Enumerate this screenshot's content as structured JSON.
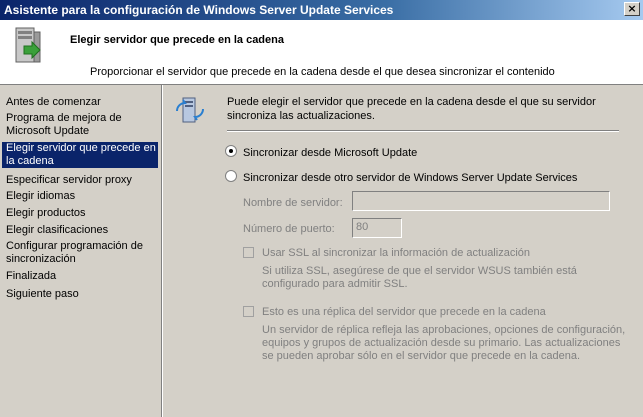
{
  "window": {
    "title": "Asistente para la configuración de Windows Server Update Services",
    "close_glyph": "×"
  },
  "header": {
    "title": "Elegir servidor que precede en la cadena",
    "description": "Proporcionar el servidor que precede en la cadena desde el que desea sincronizar el contenido"
  },
  "sidebar": {
    "items": [
      {
        "label": "Antes de comenzar"
      },
      {
        "label": "Programa de mejora de Microsoft Update"
      },
      {
        "label": "Elegir servidor que precede en la cadena",
        "selected": true
      },
      {
        "label": "Especificar servidor proxy"
      },
      {
        "label": "Elegir idiomas"
      },
      {
        "label": "Elegir productos"
      },
      {
        "label": "Elegir clasificaciones"
      },
      {
        "label": "Configurar programación de sincronización"
      },
      {
        "label": "Finalizada"
      },
      {
        "label": "Siguiente paso"
      }
    ]
  },
  "content": {
    "intro": "Puede elegir el servidor que precede en la cadena desde el que su servidor sincroniza las actualizaciones.",
    "radio_microsoft": {
      "label": "Sincronizar desde Microsoft Update",
      "checked": true
    },
    "radio_wsus": {
      "label": "Sincronizar desde otro servidor de Windows Server Update Services",
      "checked": false
    },
    "server_name": {
      "label": "Nombre de servidor:",
      "value": ""
    },
    "port": {
      "label": "Número de puerto:",
      "value": "80"
    },
    "ssl": {
      "label": "Usar SSL al sincronizar la información de actualización",
      "note": "Si utiliza SSL, asegúrese de que el servidor WSUS también está configurado para admitir SSL."
    },
    "replica": {
      "label": "Esto es una réplica del servidor que precede en la cadena",
      "note": "Un servidor de réplica refleja las aprobaciones, opciones de configuración, equipos y grupos de actualización desde su primario. Las actualizaciones se pueden aprobar sólo en el servidor que precede en la cadena."
    },
    "colors": {
      "selection": "#0a246a",
      "face": "#d4d0c8",
      "disabled_text": "#808080"
    }
  }
}
